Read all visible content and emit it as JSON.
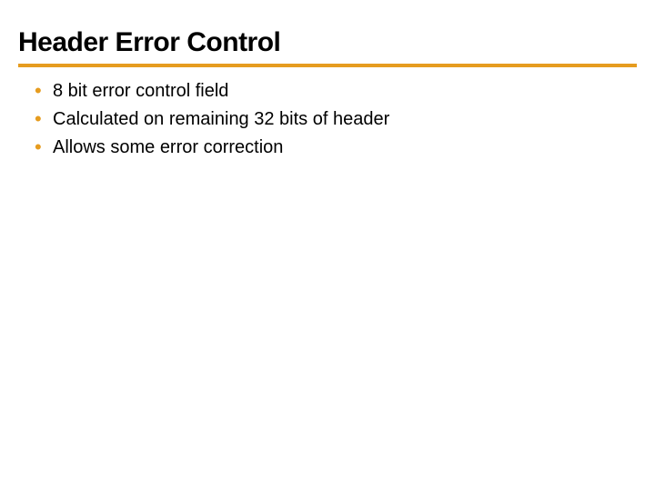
{
  "slide": {
    "title": "Header Error Control",
    "bullets": [
      "8 bit error control field",
      "Calculated on remaining 32 bits of header",
      "Allows some error correction"
    ]
  }
}
